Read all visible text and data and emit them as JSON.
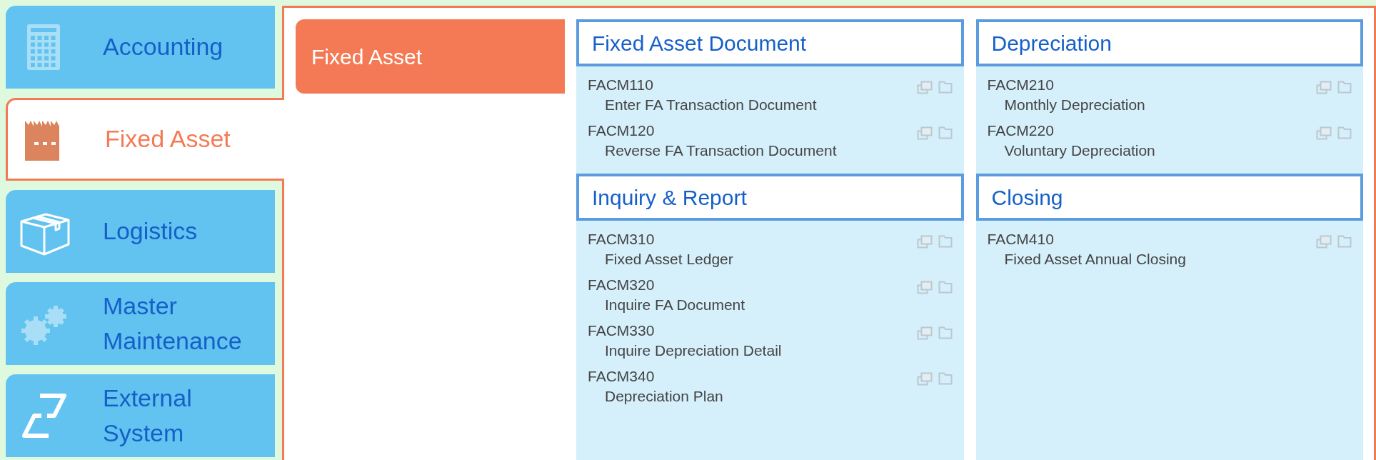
{
  "sidebar": {
    "items": [
      {
        "label": "Accounting",
        "selected": false
      },
      {
        "label": "Fixed Asset",
        "selected": true
      },
      {
        "label": "Logistics",
        "selected": false
      },
      {
        "label": "Master Maintenance",
        "selected": false
      },
      {
        "label": "External System",
        "selected": false
      }
    ]
  },
  "submenu": [
    {
      "label": "Fixed Asset",
      "selected": true
    }
  ],
  "sections": [
    {
      "title": "Fixed Asset Document",
      "items": [
        {
          "code": "FACM110",
          "title": "Enter FA Transaction Document"
        },
        {
          "code": "FACM120",
          "title": "Reverse FA Transaction Document"
        }
      ]
    },
    {
      "title": "Depreciation",
      "items": [
        {
          "code": "FACM210",
          "title": "Monthly Depreciation"
        },
        {
          "code": "FACM220",
          "title": "Voluntary Depreciation"
        }
      ]
    },
    {
      "title": "Inquiry & Report",
      "items": [
        {
          "code": "FACM310",
          "title": "Fixed Asset Ledger"
        },
        {
          "code": "FACM320",
          "title": "Inquire FA Document"
        },
        {
          "code": "FACM330",
          "title": "Inquire Depreciation Detail"
        },
        {
          "code": "FACM340",
          "title": "Depreciation Plan"
        }
      ]
    },
    {
      "title": "Closing",
      "items": [
        {
          "code": "FACM410",
          "title": "Fixed Asset Annual Closing"
        }
      ]
    }
  ]
}
